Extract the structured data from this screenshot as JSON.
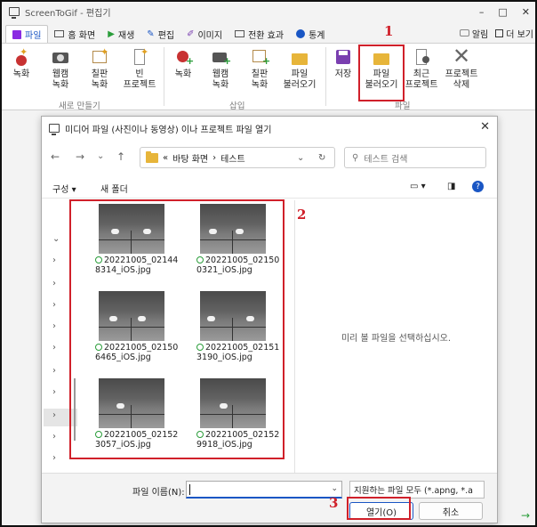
{
  "window": {
    "title": "ScreenToGif - 편집기",
    "min": "–",
    "max": "□",
    "close": "✕"
  },
  "tabs": [
    {
      "label": "파일",
      "active": true
    },
    {
      "label": "홈 화면"
    },
    {
      "label": "재생"
    },
    {
      "label": "편집"
    },
    {
      "label": "이미지"
    },
    {
      "label": "전환 효과"
    },
    {
      "label": "통계"
    }
  ],
  "tabs_right": {
    "notify": "알림",
    "more": "더 보기"
  },
  "ribbon": {
    "groups": [
      {
        "label": "새로 만들기"
      },
      {
        "label": "삽입"
      },
      {
        "label": "파일"
      }
    ],
    "buttons": [
      {
        "l1": "녹화",
        "l2": ""
      },
      {
        "l1": "웹캠",
        "l2": "녹화"
      },
      {
        "l1": "칠판",
        "l2": "녹화"
      },
      {
        "l1": "빈",
        "l2": "프로젝트"
      },
      {
        "l1": "녹화",
        "l2": ""
      },
      {
        "l1": "웹캠",
        "l2": "녹화"
      },
      {
        "l1": "칠판",
        "l2": "녹화"
      },
      {
        "l1": "파일",
        "l2": "불러오기"
      },
      {
        "l1": "저장",
        "l2": ""
      },
      {
        "l1": "파일",
        "l2": "불러오기"
      },
      {
        "l1": "최근",
        "l2": "프로젝트"
      },
      {
        "l1": "프로젝트",
        "l2": "삭제"
      }
    ]
  },
  "annotations": {
    "n1": "1",
    "n2": "2",
    "n3": "3"
  },
  "dialog": {
    "title": "미디어 파일 (사진이나 동영상) 이나 프로젝트 파일 열기",
    "close": "✕",
    "address": {
      "prefix": "«",
      "crumb1": "바탕 화면",
      "sep": "›",
      "crumb2": "테스트"
    },
    "search_placeholder": "테스트 검색",
    "cmd": {
      "organize": "구성 ▾",
      "new_folder": "새 폴더"
    },
    "files": [
      {
        "name": "20221005_021448314_iOS.jpg"
      },
      {
        "name": "20221005_021500321_iOS.jpg"
      },
      {
        "name": "20221005_021506465_iOS.jpg"
      },
      {
        "name": "20221005_021513190_iOS.jpg"
      },
      {
        "name": "20221005_021523057_iOS.jpg"
      },
      {
        "name": "20221005_021529918_iOS.jpg"
      }
    ],
    "preview_text": "미리 볼 파일을 선택하십시오.",
    "filename_label": "파일 이름(N):",
    "filename_value": "",
    "filetype": "지원하는 파일 모두 (*.apng, *.a",
    "open": "열기(O)",
    "cancel": "취소"
  }
}
